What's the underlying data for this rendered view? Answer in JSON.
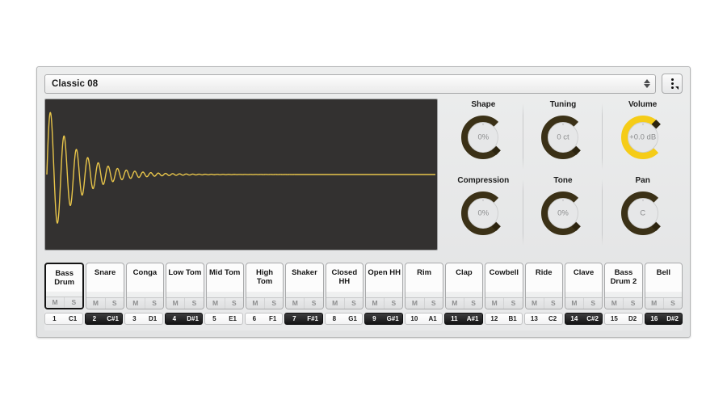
{
  "header": {
    "preset_name": "Classic 08",
    "stepper_icon": "up-down-arrows-icon",
    "menu_icon": "vertical-dots-menu-icon"
  },
  "waveform": {
    "name": "bass-drum-waveform",
    "stroke_color": "#e8c54a",
    "background_color": "#333130",
    "description": "decaying sine wave"
  },
  "knobs": [
    {
      "label": "Shape",
      "value": "0%",
      "ring_color": "#3b3117",
      "fill": 0.0
    },
    {
      "label": "Tuning",
      "value": "0 ct",
      "ring_color": "#3b3117",
      "fill": 0.0
    },
    {
      "label": "Volume",
      "value": "+0.0 dB",
      "ring_color": "#f5cc18",
      "fill": 1.0
    },
    {
      "label": "Compression",
      "value": "0%",
      "ring_color": "#3b3117",
      "fill": 0.0
    },
    {
      "label": "Tone",
      "value": "0%",
      "ring_color": "#3b3117",
      "fill": 0.0
    },
    {
      "label": "Pan",
      "value": "C",
      "ring_color": "#3b3117",
      "fill": 0.0
    }
  ],
  "pads": {
    "mute_label": "M",
    "solo_label": "S",
    "selected_index": 0,
    "items": [
      {
        "name": "Bass Drum",
        "note_num": "1",
        "note_name": "C1",
        "black": false
      },
      {
        "name": "Snare",
        "note_num": "2",
        "note_name": "C#1",
        "black": true
      },
      {
        "name": "Conga",
        "note_num": "3",
        "note_name": "D1",
        "black": false
      },
      {
        "name": "Low Tom",
        "note_num": "4",
        "note_name": "D#1",
        "black": true
      },
      {
        "name": "Mid Tom",
        "note_num": "5",
        "note_name": "E1",
        "black": false
      },
      {
        "name": "High Tom",
        "note_num": "6",
        "note_name": "F1",
        "black": false
      },
      {
        "name": "Shaker",
        "note_num": "7",
        "note_name": "F#1",
        "black": true
      },
      {
        "name": "Closed HH",
        "note_num": "8",
        "note_name": "G1",
        "black": false
      },
      {
        "name": "Open HH",
        "note_num": "9",
        "note_name": "G#1",
        "black": true
      },
      {
        "name": "Rim",
        "note_num": "10",
        "note_name": "A1",
        "black": false
      },
      {
        "name": "Clap",
        "note_num": "11",
        "note_name": "A#1",
        "black": true
      },
      {
        "name": "Cowbell",
        "note_num": "12",
        "note_name": "B1",
        "black": false
      },
      {
        "name": "Ride",
        "note_num": "13",
        "note_name": "C2",
        "black": false
      },
      {
        "name": "Clave",
        "note_num": "14",
        "note_name": "C#2",
        "black": true
      },
      {
        "name": "Bass Drum 2",
        "note_num": "15",
        "note_name": "D2",
        "black": false
      },
      {
        "name": "Bell",
        "note_num": "16",
        "note_name": "D#2",
        "black": true
      }
    ]
  }
}
